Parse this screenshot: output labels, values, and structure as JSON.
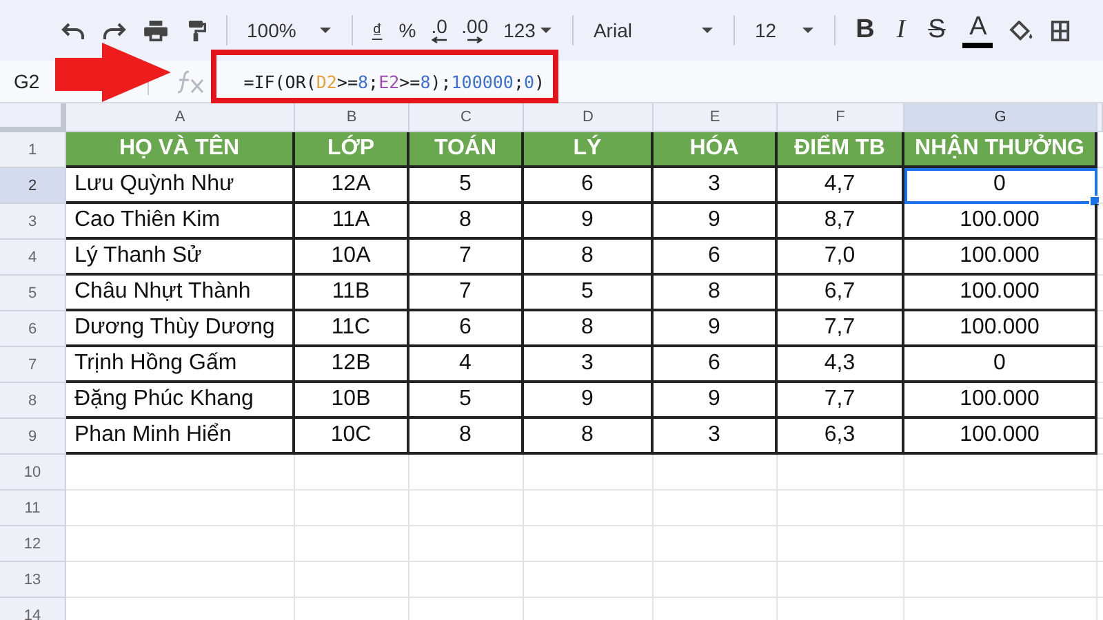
{
  "toolbar": {
    "zoom": "100%",
    "currency": "₫",
    "percent": "%",
    "decrease_decimals": ".0",
    "increase_decimals": ".00",
    "number_format": "123",
    "font": "Arial",
    "font_size": "12",
    "bold": "B",
    "italic": "I",
    "strikethrough": "S",
    "text_color": "A"
  },
  "formula_bar": {
    "name_box": "G2",
    "tokens": [
      {
        "text": "=IF(OR(",
        "color": "#202124"
      },
      {
        "text": "D2",
        "color": "#e8a13a"
      },
      {
        "text": ">=",
        "color": "#202124"
      },
      {
        "text": "8",
        "color": "#3b6fd6"
      },
      {
        "text": ";",
        "color": "#202124"
      },
      {
        "text": "E2",
        "color": "#9c4fb8"
      },
      {
        "text": ">=",
        "color": "#202124"
      },
      {
        "text": "8",
        "color": "#3b6fd6"
      },
      {
        "text": ");",
        "color": "#202124"
      },
      {
        "text": "100000",
        "color": "#3b6fd6"
      },
      {
        "text": ";",
        "color": "#202124"
      },
      {
        "text": "0",
        "color": "#3b6fd6"
      },
      {
        "text": ")",
        "color": "#202124"
      }
    ]
  },
  "columns": [
    {
      "label": "A",
      "selected": false
    },
    {
      "label": "B",
      "selected": false
    },
    {
      "label": "C",
      "selected": false
    },
    {
      "label": "D",
      "selected": false
    },
    {
      "label": "E",
      "selected": false
    },
    {
      "label": "F",
      "selected": false
    },
    {
      "label": "G",
      "selected": true
    }
  ],
  "rows": [
    {
      "number": "1",
      "kind": "header",
      "selected": false,
      "cells": [
        "HỌ VÀ TÊN",
        "LỚP",
        "TOÁN",
        "LÝ",
        "HÓA",
        "ĐIỂM TB",
        "NHẬN THƯỞNG"
      ]
    },
    {
      "number": "2",
      "kind": "data",
      "selected": true,
      "cells": [
        "Lưu Quỳnh Như",
        "12A",
        "5",
        "6",
        "3",
        "4,7",
        "0"
      ]
    },
    {
      "number": "3",
      "kind": "data",
      "selected": false,
      "cells": [
        "Cao Thiên Kim",
        "11A",
        "8",
        "9",
        "9",
        "8,7",
        "100.000"
      ]
    },
    {
      "number": "4",
      "kind": "data",
      "selected": false,
      "cells": [
        "Lý Thanh Sử",
        "10A",
        "7",
        "8",
        "6",
        "7,0",
        "100.000"
      ]
    },
    {
      "number": "5",
      "kind": "data",
      "selected": false,
      "cells": [
        "Châu Nhựt Thành",
        "11B",
        "7",
        "5",
        "8",
        "6,7",
        "100.000"
      ]
    },
    {
      "number": "6",
      "kind": "data",
      "selected": false,
      "cells": [
        "Dương Thùy Dương",
        "11C",
        "6",
        "8",
        "9",
        "7,7",
        "100.000"
      ]
    },
    {
      "number": "7",
      "kind": "data",
      "selected": false,
      "cells": [
        "Trịnh Hồng Gấm",
        "12B",
        "4",
        "3",
        "6",
        "4,3",
        "0"
      ]
    },
    {
      "number": "8",
      "kind": "data",
      "selected": false,
      "cells": [
        "Đặng Phúc Khang",
        "10B",
        "5",
        "9",
        "9",
        "7,7",
        "100.000"
      ]
    },
    {
      "number": "9",
      "kind": "data",
      "selected": false,
      "cells": [
        "Phan Minh Hiển",
        "10C",
        "8",
        "8",
        "3",
        "6,3",
        "100.000"
      ]
    },
    {
      "number": "10",
      "kind": "empty",
      "selected": false
    },
    {
      "number": "11",
      "kind": "empty",
      "selected": false
    },
    {
      "number": "12",
      "kind": "empty",
      "selected": false
    },
    {
      "number": "13",
      "kind": "empty",
      "selected": false
    },
    {
      "number": "14",
      "kind": "empty",
      "selected": false
    }
  ]
}
